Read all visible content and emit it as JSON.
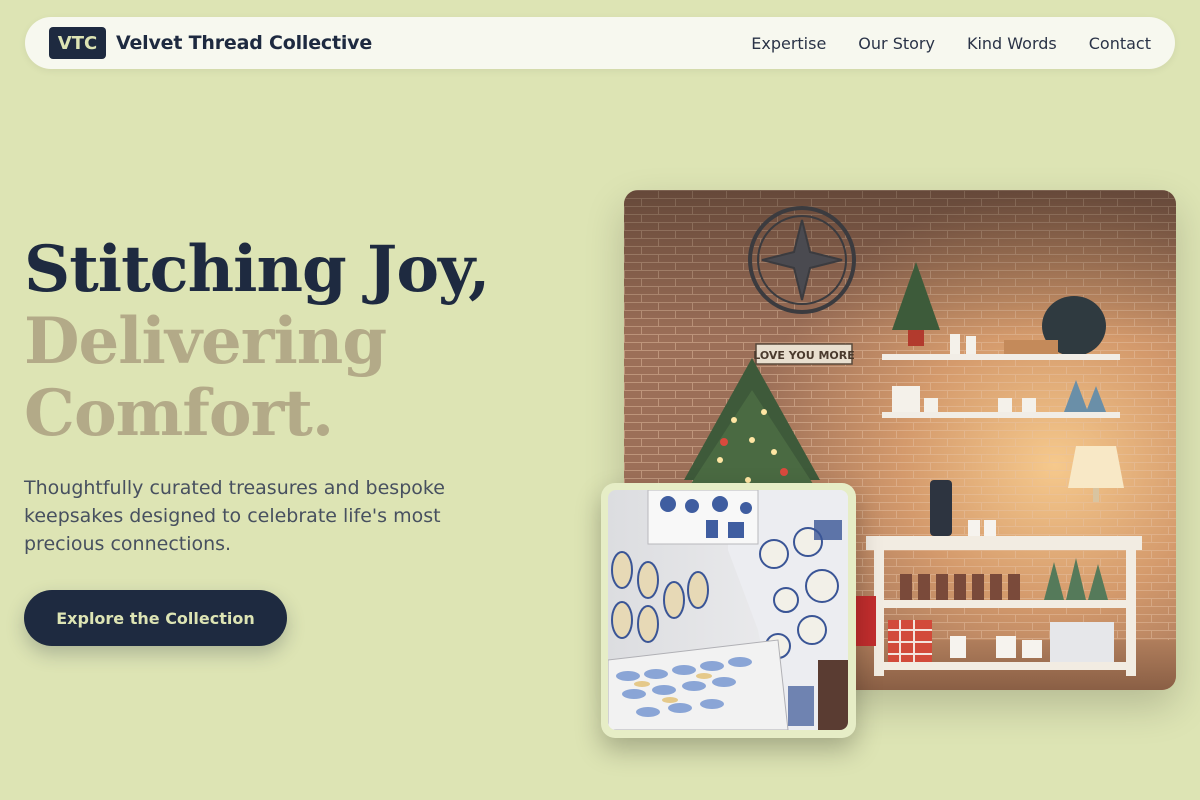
{
  "brand": {
    "badge": "VTC",
    "name": "Velvet Thread Collective"
  },
  "nav": {
    "links": [
      "Expertise",
      "Our Story",
      "Kind Words",
      "Contact"
    ]
  },
  "hero": {
    "title_line1": "Stitching Joy,",
    "title_line2": "Delivering",
    "title_line3": "Comfort.",
    "subtitle": "Thoughtfully curated treasures and bespoke keepsakes designed to celebrate life's most precious connections.",
    "cta_label": "Explore the Collection",
    "main_image_sign": "LOVE YOU MORE"
  },
  "colors": {
    "background": "#dde4b4",
    "navy": "#1e2a40",
    "muted_title": "#b3aa88",
    "nav_bg": "#f7f8ef"
  }
}
